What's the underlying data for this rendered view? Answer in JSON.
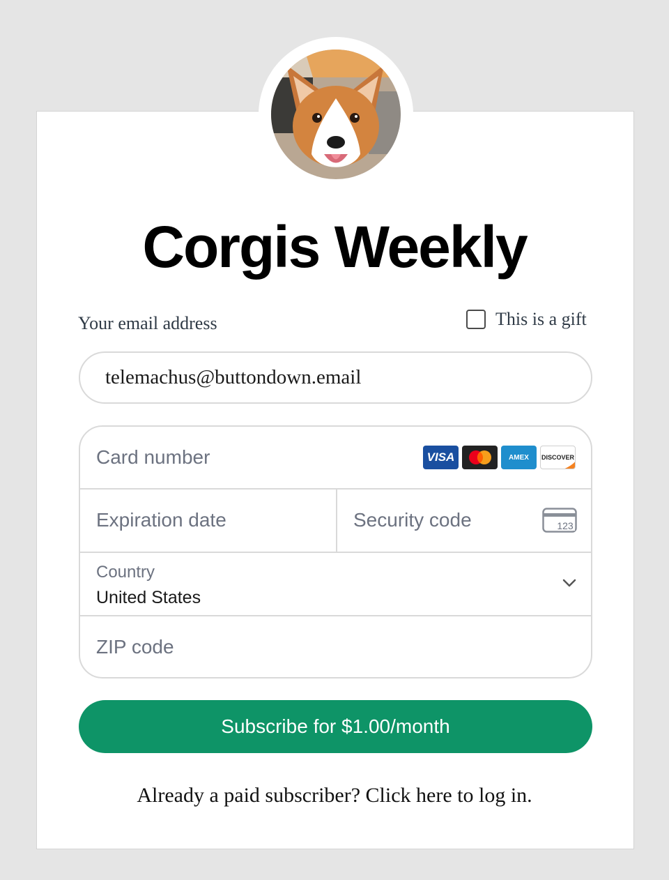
{
  "newsletter": {
    "title": "Corgis Weekly"
  },
  "form": {
    "email_label": "Your email address",
    "email_value": "telemachus@buttondown.email",
    "gift_label": "This is a gift",
    "gift_checked": false
  },
  "payment": {
    "card_number_placeholder": "Card number",
    "card_brands": [
      "VISA",
      "Mastercard",
      "AMEX",
      "DISCOVER"
    ],
    "expiration_placeholder": "Expiration date",
    "security_placeholder": "Security code",
    "security_icon_text": "123",
    "country_label": "Country",
    "country_value": "United States",
    "zip_placeholder": "ZIP code"
  },
  "actions": {
    "subscribe_label": "Subscribe for $1.00/month",
    "login_text": "Already a paid subscriber? Click here to log in."
  },
  "colors": {
    "accent": "#0e9467",
    "background": "#e5e5e5",
    "card": "#ffffff"
  }
}
